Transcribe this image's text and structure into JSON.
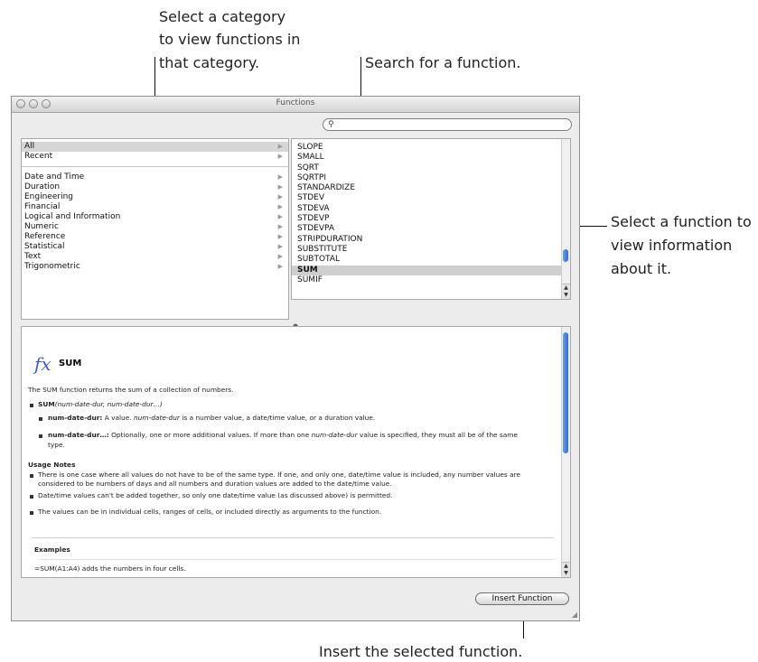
{
  "callouts": {
    "category_l1": "Select a category",
    "category_l2": "to view functions in",
    "category_l3": "that category.",
    "search": "Search for a function.",
    "function_l1": "Select a function to",
    "function_l2": "view information",
    "function_l3": "about it.",
    "insert": "Insert the selected function."
  },
  "window": {
    "title": "Functions"
  },
  "search": {
    "value": "",
    "placeholder": ""
  },
  "categories": {
    "top": [
      {
        "label": "All",
        "selected": true
      },
      {
        "label": "Recent",
        "selected": false
      }
    ],
    "groups": [
      "Date and Time",
      "Duration",
      "Engineering",
      "Financial",
      "Logical and Information",
      "Numeric",
      "Reference",
      "Statistical",
      "Text",
      "Trigonometric"
    ]
  },
  "functions": {
    "items": [
      "SLOPE",
      "SMALL",
      "SQRT",
      "SQRTPI",
      "STANDARDIZE",
      "STDEV",
      "STDEVA",
      "STDEVP",
      "STDEVPA",
      "STRIPDURATION",
      "SUBSTITUTE",
      "SUBTOTAL",
      "SUM",
      "SUMIF"
    ],
    "selected": "SUM"
  },
  "info": {
    "fx_symbol": "fx",
    "name": "SUM",
    "description": "The SUM function returns the sum of a collection of numbers.",
    "syntax_name": "SUM",
    "syntax_args": "(num-date-dur, num-date-dur…)",
    "arg1_name": "num-date-dur:",
    "arg1_text_a": " A value. ",
    "arg1_italic": "num-date-dur",
    "arg1_text_b": " is a number value, a date/time value, or a duration value.",
    "arg2_name": "num-date-dur…:",
    "arg2_text_a": " Optionally, one or more additional values. If more than one ",
    "arg2_italic": "num-date-dur",
    "arg2_text_b": " value is specified, they must all be of the same",
    "arg2_text_c": "type.",
    "usage_heading": "Usage Notes",
    "note1_a": "There is one case where all values do not have to be of the same type. If one, and only one, date/time value is included, any number values are",
    "note1_b": "considered to be numbers of days and all numbers and duration values are added to the date/time value.",
    "note2": "Date/time values can't be added together, so only one date/time value (as discussed above) is permitted.",
    "note3": "The values can be in individual cells, ranges of cells, or included directly as arguments to the function.",
    "examples_heading": "Examples",
    "example1": "=SUM(A1:A4) adds the numbers in four cells."
  },
  "buttons": {
    "insert": "Insert Function"
  },
  "colors": {
    "fx": "#3b5fc9",
    "scroll_thumb": "#2f6fd3"
  }
}
